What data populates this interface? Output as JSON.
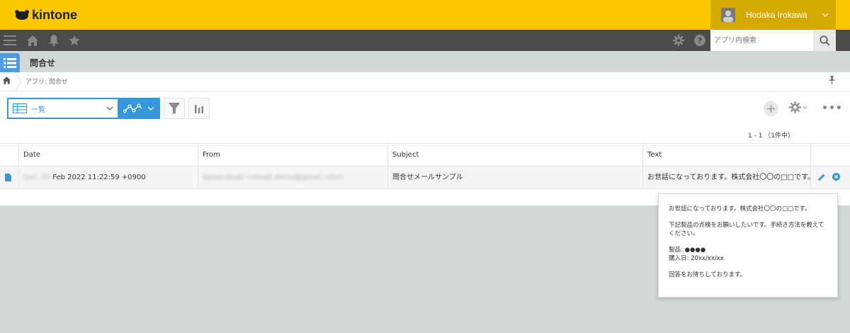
{
  "header": {
    "logo_text": "kintone",
    "user_name": "Hodaka Irokawa",
    "accent": "#fcc800"
  },
  "navbar": {
    "icons": [
      "menu-icon",
      "home-icon",
      "bell-icon",
      "star-icon",
      "gear-icon",
      "help-icon"
    ],
    "search_placeholder": "アプリ内検索"
  },
  "app": {
    "title": "問合せ"
  },
  "breadcrumb": {
    "text": "アプリ: 問合せ"
  },
  "toolbar": {
    "view_label": "一覧"
  },
  "pager": {
    "text": "1 - 1 （1件中）"
  },
  "table": {
    "columns": [
      "Date",
      "From",
      "Subject",
      "Text"
    ],
    "rows": [
      {
        "date_blurred": "Sun, 20",
        "date_visible": "Feb 2022 11:22:59 +0900",
        "from": "demo.email <email.demo@gmail.com>",
        "subject": "問合せメールサンプル",
        "text": "お世話になっております。株式会社〇〇の□□です。…"
      }
    ]
  },
  "popup": {
    "lines": [
      "お世話になっております。株式会社〇〇の□□です。",
      "下記製品の点検をお願いしたいです。手続き方法を教えてください。",
      "製品: ●●●●",
      "購入日: 20xx/xx/xx",
      "回答をお待ちしております。"
    ]
  }
}
